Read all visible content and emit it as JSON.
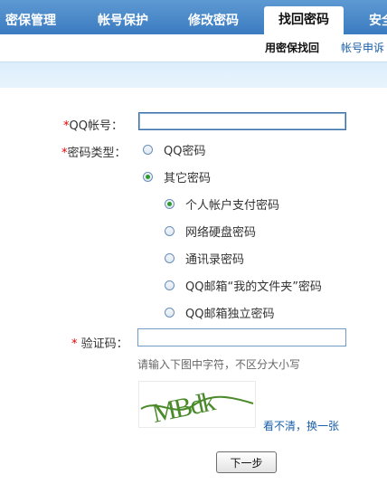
{
  "tabs": [
    {
      "label": "密保管理"
    },
    {
      "label": "帐号保护"
    },
    {
      "label": "修改密码"
    },
    {
      "label": "找回密码",
      "active": true
    },
    {
      "label": "安全"
    }
  ],
  "subnav": {
    "current": "用密保找回",
    "link": "帐号申诉"
  },
  "form": {
    "qq_label": "QQ帐号：",
    "qq_value": "",
    "type_label": "密码类型：",
    "type_options": [
      {
        "label": "QQ密码",
        "checked": false
      },
      {
        "label": "其它密码",
        "checked": true
      }
    ],
    "sub_options": [
      {
        "label": "个人帐户支付密码",
        "checked": true
      },
      {
        "label": "网络硬盘密码",
        "checked": false
      },
      {
        "label": "通讯录密码",
        "checked": false
      },
      {
        "label": "QQ邮箱“我的文件夹”密码",
        "checked": false
      },
      {
        "label": "QQ邮箱独立密码",
        "checked": false
      }
    ],
    "captcha_label": "验证码：",
    "captcha_value": "",
    "captcha_hint": "请输入下图中字符，不区分大小写",
    "captcha_text": "MBdk",
    "refresh_link": "看不清，换一张",
    "next_button": "下一步",
    "required_mark": "*"
  },
  "colors": {
    "tabbar": "#3b7bc0",
    "link": "#1a5fa8",
    "required": "#e60000",
    "captcha_ink": "#4a8a2a"
  }
}
